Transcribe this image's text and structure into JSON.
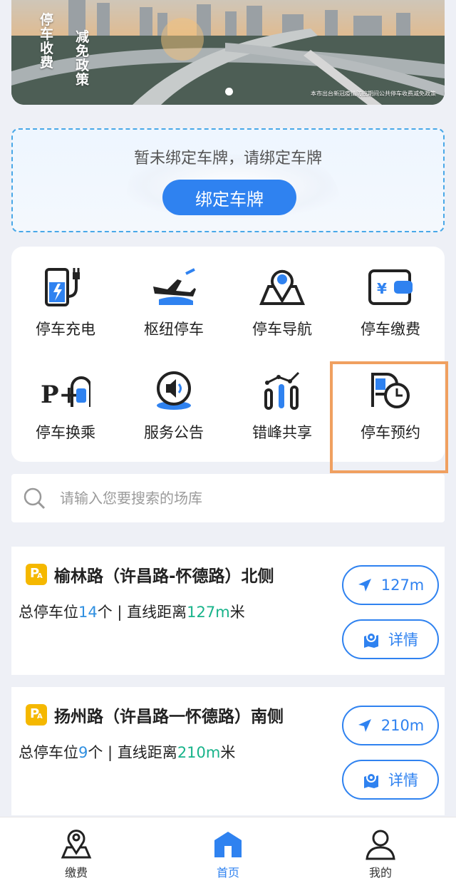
{
  "banner": {
    "vertical_text_1": "停车收费",
    "vertical_text_2": "减免政策",
    "caption": "本市出台新冠疫情防控期间公共停车收费减免政策",
    "page_indicator_index": 1
  },
  "bind": {
    "hint": "暂未绑定车牌，请绑定车牌",
    "button": "绑定车牌"
  },
  "services": [
    {
      "label": "停车充电",
      "icon": "ev-charger-icon"
    },
    {
      "label": "枢纽停车",
      "icon": "airplane-train-icon"
    },
    {
      "label": "停车导航",
      "icon": "map-pin-icon"
    },
    {
      "label": "停车缴费",
      "icon": "wallet-yen-icon"
    },
    {
      "label": "停车换乘",
      "icon": "park-and-ride-icon"
    },
    {
      "label": "服务公告",
      "icon": "speaker-icon"
    },
    {
      "label": "错峰共享",
      "icon": "bar-share-icon"
    },
    {
      "label": "停车预约",
      "icon": "parking-clock-icon"
    }
  ],
  "search": {
    "placeholder": "请输入您要搜索的场库"
  },
  "parking_lots": [
    {
      "name": "榆林路（许昌路-怀德路）北侧",
      "spaces_label": "总停车位",
      "spaces": "14",
      "spaces_unit": "个",
      "separator": " | ",
      "distance_label": "直线距离",
      "distance": "127m",
      "distance_unit": "米",
      "nav_label": "127m",
      "detail_label": "详情"
    },
    {
      "name": "扬州路（许昌路一怀德路）南侧",
      "spaces_label": "总停车位",
      "spaces": "9",
      "spaces_unit": "个",
      "separator": " | ",
      "distance_label": "直线距离",
      "distance": "210m",
      "distance_unit": "米",
      "nav_label": "210m",
      "detail_label": "详情"
    }
  ],
  "parking_icon_text": {
    "main": "P",
    "sub": "A"
  },
  "nav": {
    "items": [
      {
        "label": "缴费",
        "icon": "location-pin-icon"
      },
      {
        "label": "首页",
        "icon": "home-icon"
      },
      {
        "label": "我的",
        "icon": "user-icon"
      }
    ],
    "active_index": 1
  },
  "colors": {
    "accent": "#2f82f0",
    "distance": "#18b38a",
    "count": "#2f8fe0",
    "highlight_border": "#f0a060",
    "parking_badge": "#f5b800"
  }
}
